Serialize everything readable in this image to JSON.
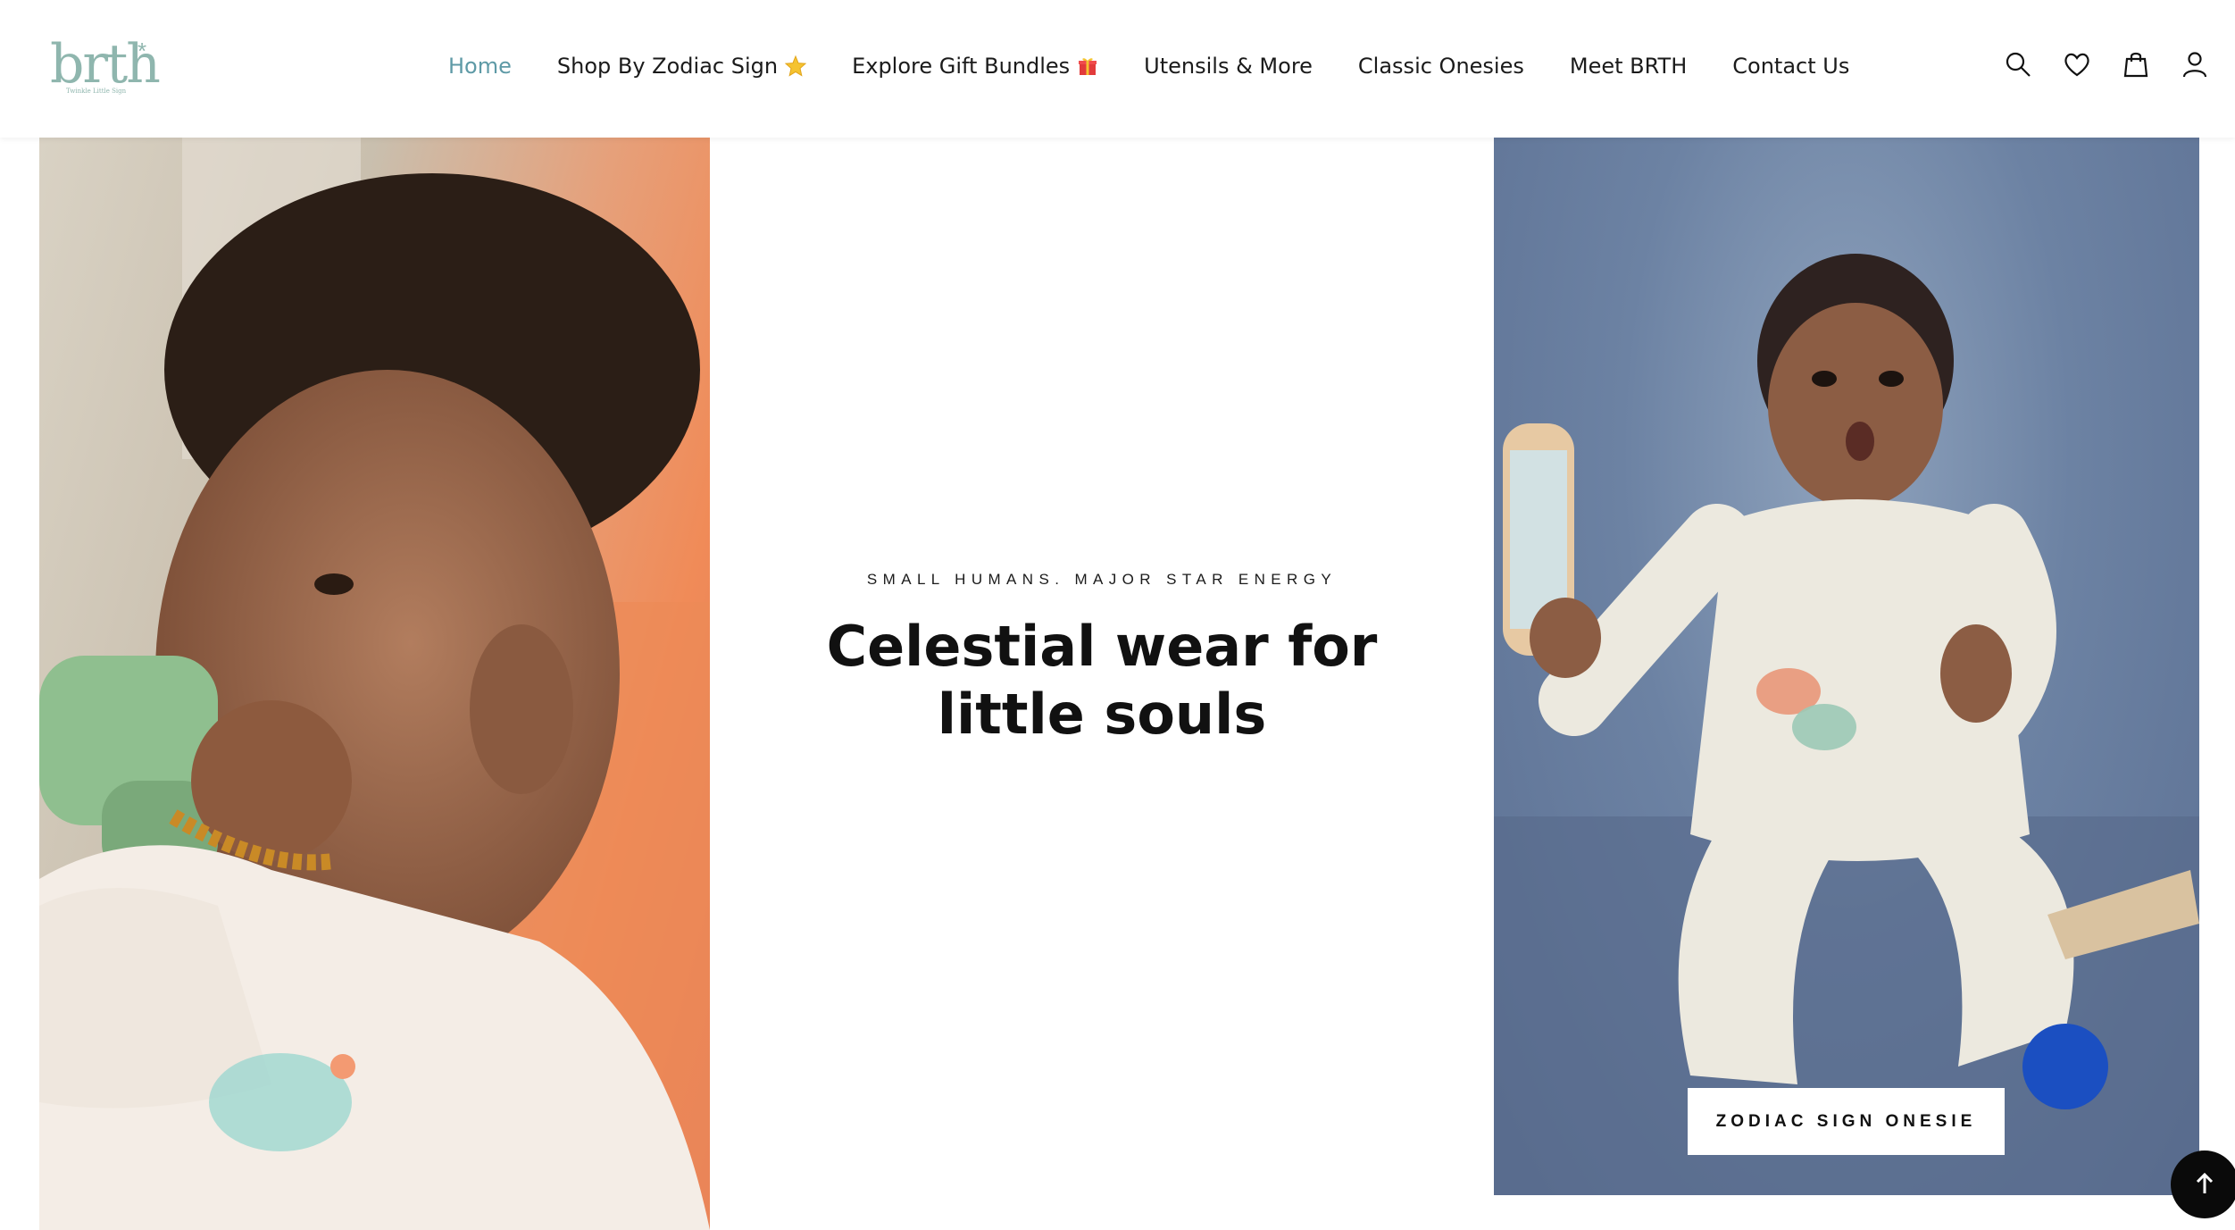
{
  "brand": {
    "logo_text": "brth",
    "logo_mark": "*",
    "tagline": "Twinkle Little Sign",
    "color": "#8fb6ae"
  },
  "nav": {
    "items": [
      {
        "label": "Home",
        "active": true
      },
      {
        "label": "Shop By Zodiac Sign",
        "icon": "star-emoji"
      },
      {
        "label": "Explore Gift Bundles",
        "icon": "gift-emoji"
      },
      {
        "label": "Utensils & More"
      },
      {
        "label": "Classic Onesies"
      },
      {
        "label": "Meet BRTH"
      },
      {
        "label": "Contact Us"
      }
    ],
    "active_color": "#5e9aa6"
  },
  "header_icons": [
    "search-icon",
    "heart-icon",
    "shopping-bag-icon",
    "user-icon"
  ],
  "hero": {
    "tagline": "SMALL HUMANS. MAJOR STAR ENERGY",
    "headline": "Celestial wear for little souls"
  },
  "promo": {
    "button_label": "ZODIAC SIGN ONESIE"
  },
  "scroll_top": {
    "icon": "arrow-up-icon"
  }
}
